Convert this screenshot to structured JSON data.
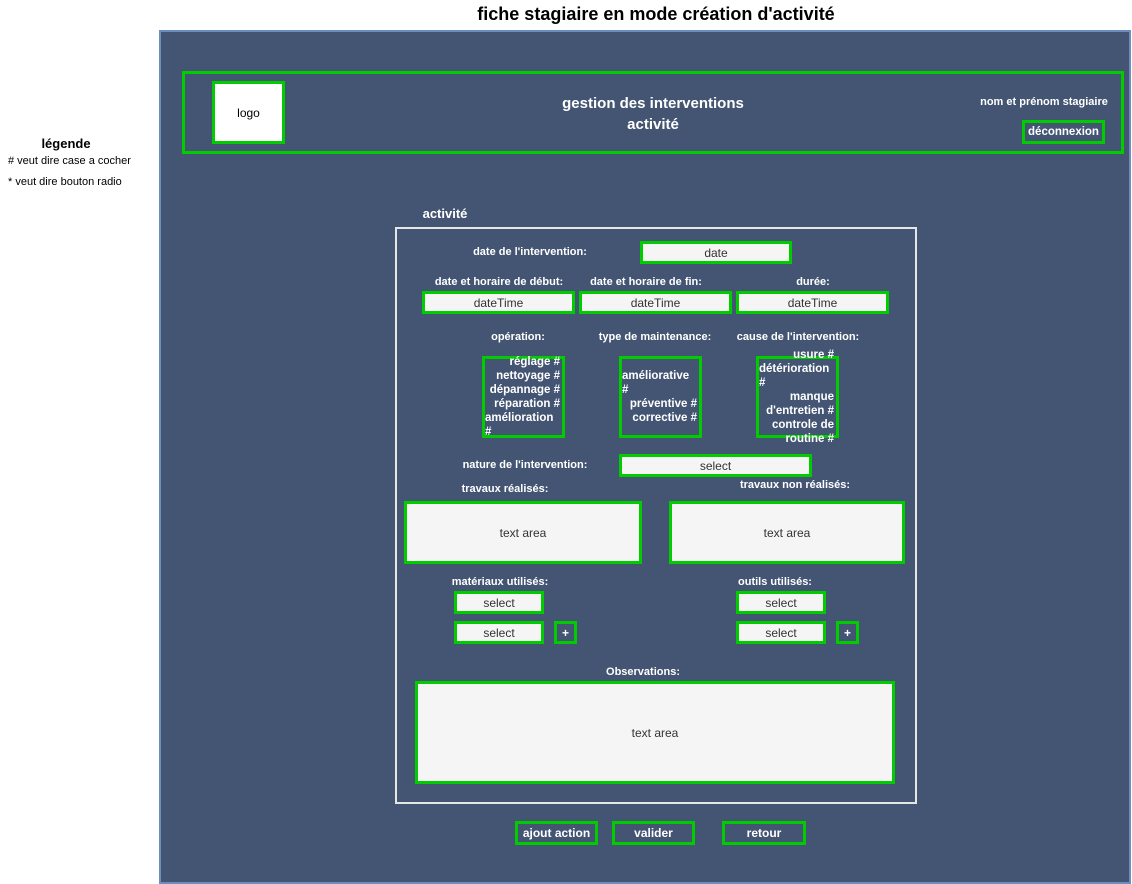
{
  "page_title": "fiche stagiaire en mode création d'activité",
  "legend": {
    "title": "légende",
    "lines": [
      "# veut dire case a cocher",
      "* veut dire bouton radio"
    ]
  },
  "header": {
    "logo": "logo",
    "title_line1": "gestion des interventions",
    "title_line2": "activité",
    "user_name": "nom et prénom stagiaire",
    "logout": "déconnexion"
  },
  "section_title": "activité",
  "form": {
    "date_label": "date de l'intervention:",
    "date_value": "date",
    "start_label": "date et horaire de début:",
    "start_value": "dateTime",
    "end_label": "date et horaire de fin:",
    "end_value": "dateTime",
    "duration_label": "durée:",
    "duration_value": "dateTime",
    "operation_label": "opération:",
    "operation_options": [
      "réglage #",
      "nettoyage #",
      "dépannage #",
      "réparation #",
      "amélioration #"
    ],
    "maintenance_label": "type de maintenance:",
    "maintenance_options": [
      "améliorative #",
      "préventive #",
      "corrective #"
    ],
    "cause_label": "cause de l'intervention:",
    "cause_options": [
      "usure #",
      "détérioration #",
      "manque",
      "d'entretien #",
      "controle de",
      "routine #"
    ],
    "nature_label": "nature de l'intervention:",
    "nature_value": "select",
    "done_label": "travaux réalisés:",
    "done_value": "text area",
    "notdone_label": "travaux non réalisés:",
    "notdone_value": "text area",
    "materials_label": "matériaux utilisés:",
    "materials_select1": "select",
    "materials_select2": "select",
    "tools_label": "outils utilisés:",
    "tools_select1": "select",
    "tools_select2": "select",
    "add_label": "+",
    "observations_label": "Observations:",
    "observations_value": "text area"
  },
  "actions": {
    "add_action": "ajout action",
    "validate": "valider",
    "back": "retour"
  }
}
